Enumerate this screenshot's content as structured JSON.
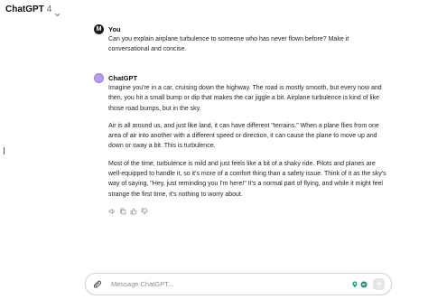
{
  "header": {
    "title": "ChatGPT",
    "version": "4"
  },
  "conversation": {
    "user": {
      "author": "You",
      "avatar_letter": "M",
      "text": "Can you explain airplane turbulence to someone who has never flown before? Make it conversational and concise."
    },
    "assistant": {
      "author": "ChatGPT",
      "paragraphs": [
        "Imagine you're in a car, cruising down the highway. The road is mostly smooth, but every now and then, you hit a small bump or dip that makes the car jiggle a bit. Airplane turbulence is kind of like those road bumps, but in the sky.",
        "Air is all around us, and just like land, it can have different \"terrains.\" When a plane flies from one area of air into another with a different speed or direction, it can cause the plane to move up and down or sway a bit. This is turbulence.",
        "Most of the time, turbulence is mild and just feels like a bit of a shaky ride. Pilots and planes are well-equipped to handle it, so it's more of a comfort thing than a safety issue. Think of it as the sky's way of saying, \"Hey, just reminding you I'm here!\" It's a normal part of flying, and while it might feel strange the first time, it's nothing to worry about."
      ],
      "action_icons": [
        "speaker-icon",
        "copy-icon",
        "thumbs-up-icon",
        "thumbs-down-icon"
      ]
    }
  },
  "composer": {
    "placeholder": "Message ChatGPT...",
    "value": ""
  },
  "colors": {
    "accent_avatar": "#b79cf0",
    "ext_green": "#19a37f",
    "ext_teal": "#2a8a7a"
  }
}
